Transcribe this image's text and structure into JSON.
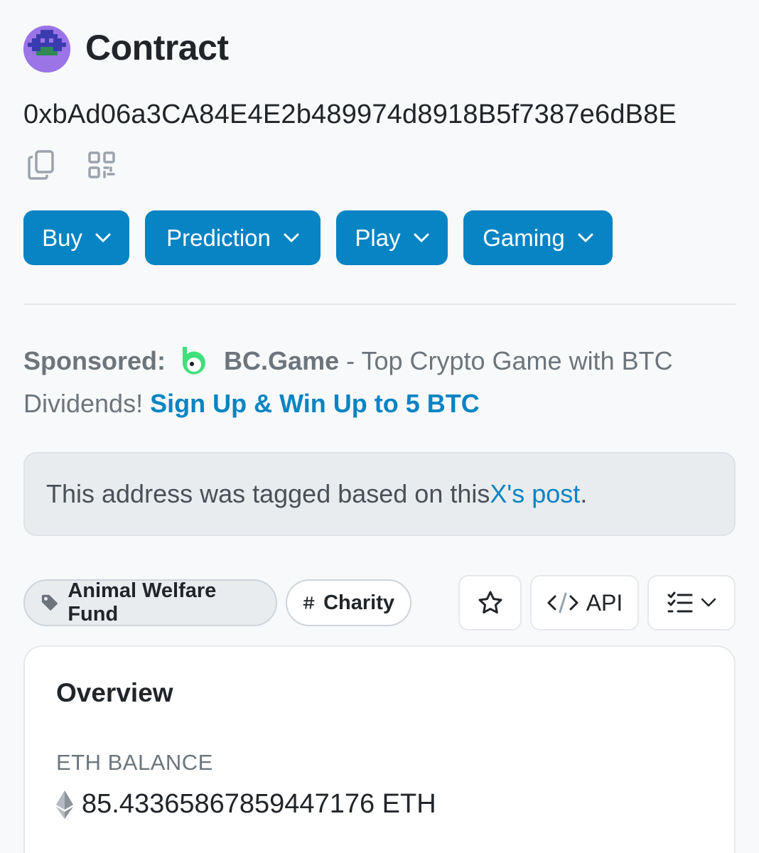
{
  "header": {
    "title": "Contract",
    "address": "0xbAd06a3CA84E4E2b489974d8918B5f7387e6dB8E"
  },
  "icons": {
    "copy": "copy-icon",
    "qr": "qr-code-icon"
  },
  "menu_buttons": [
    {
      "label": "Buy"
    },
    {
      "label": "Prediction"
    },
    {
      "label": "Play"
    },
    {
      "label": "Gaming"
    }
  ],
  "sponsored": {
    "prefix": "Sponsored:",
    "brand": "BC.Game",
    "text": " - Top Crypto Game with BTC Dividends! ",
    "cta": "Sign Up & Win Up to 5 BTC"
  },
  "alert": {
    "text": "This address was tagged based on this ",
    "link": "X's post",
    "suffix": "."
  },
  "tags": [
    {
      "label": "Animal Welfare Fund",
      "icon": "tag-icon"
    },
    {
      "label": "Charity",
      "icon": "hash-icon"
    }
  ],
  "tools": {
    "favorite_icon": "star-icon",
    "api_label": "API",
    "more_icon": "list-check-icon"
  },
  "overview": {
    "title": "Overview",
    "balance_label": "ETH BALANCE",
    "balance_value": "85.4336586785944 7176 ETH"
  },
  "colors": {
    "accent": "#0784c3",
    "background": "#f8f9fa",
    "muted": "#6c757d"
  }
}
